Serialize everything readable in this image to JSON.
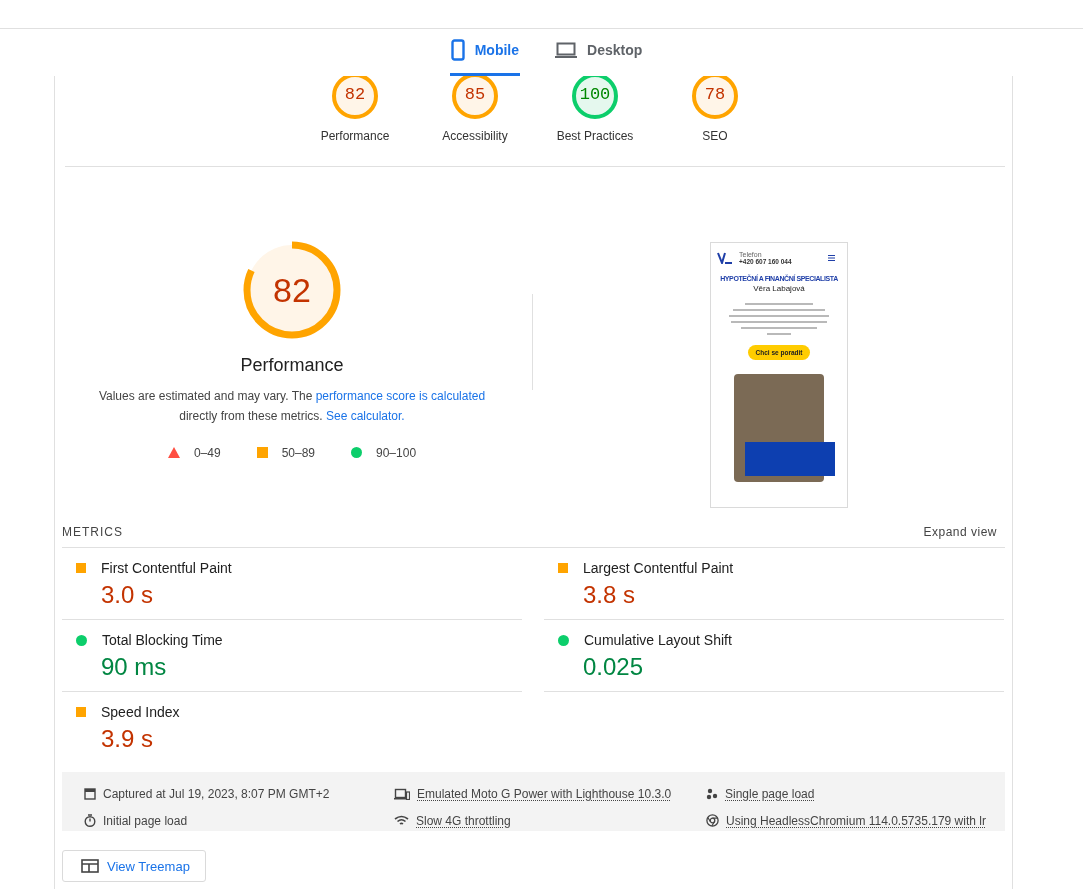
{
  "tabs": [
    {
      "label": "Mobile",
      "kind": "phone",
      "selected": true
    },
    {
      "label": "Desktop",
      "kind": "laptop",
      "selected": false
    }
  ],
  "category_gauges": [
    {
      "score": "82",
      "label": "Performance",
      "kind": "average"
    },
    {
      "score": "85",
      "label": "Accessibility",
      "kind": "average"
    },
    {
      "score": "100",
      "label": "Best Practices",
      "kind": "pass"
    },
    {
      "score": "78",
      "label": "SEO",
      "kind": "average"
    }
  ],
  "performance": {
    "score": "82",
    "level": 0.82,
    "kind": "average",
    "title": "Performance",
    "description": [
      {
        "text": "Values are estimated and may vary. The ",
        "kind": "text"
      },
      {
        "text": "performance score is calculated",
        "kind": "link"
      },
      {
        "text": " directly from these metrics. ",
        "kind": "text"
      },
      {
        "text": "See calculator.",
        "kind": "link"
      }
    ],
    "legend": [
      {
        "kind": "fail",
        "label": "0–49"
      },
      {
        "kind": "average",
        "label": "50–89"
      },
      {
        "kind": "pass",
        "label": "90–100"
      }
    ]
  },
  "screenshot": {
    "phone_label": "Telefon",
    "phone": "+420 607 160 044",
    "eyebrow": "HYPOTEČNÍ A FINANČNÍ SPECIALISTA",
    "name": "Věra Labajová",
    "button": "Chci se poradit"
  },
  "metrics": {
    "title": "METRICS",
    "toggle": "Expand view",
    "items": [
      {
        "name": "First Contentful Paint",
        "value": "3.0 s",
        "kind": "average"
      },
      {
        "name": "Largest Contentful Paint",
        "value": "3.8 s",
        "kind": "average"
      },
      {
        "name": "Total Blocking Time",
        "value": "90 ms",
        "kind": "pass"
      },
      {
        "name": "Cumulative Layout Shift",
        "value": "0.025",
        "kind": "pass"
      },
      {
        "name": "Speed Index",
        "value": "3.9 s",
        "kind": "average"
      }
    ]
  },
  "run_info": [
    {
      "kind": "calendar",
      "text": "Captured at Jul 19, 2023, 8:07 PM GMT+2",
      "link": false
    },
    {
      "kind": "devices",
      "text": "Emulated Moto G Power with Lighthouse 10.3.0",
      "link": true
    },
    {
      "kind": "dots",
      "text": "Single page load",
      "link": true
    },
    {
      "kind": "timer",
      "text": "Initial page load",
      "link": false
    },
    {
      "kind": "wifi",
      "text": "Slow 4G throttling",
      "link": true
    },
    {
      "kind": "browser",
      "text": "Using HeadlessChromium 114.0.5735.179 with lr",
      "link": true
    }
  ],
  "treemap_button": "View Treemap"
}
